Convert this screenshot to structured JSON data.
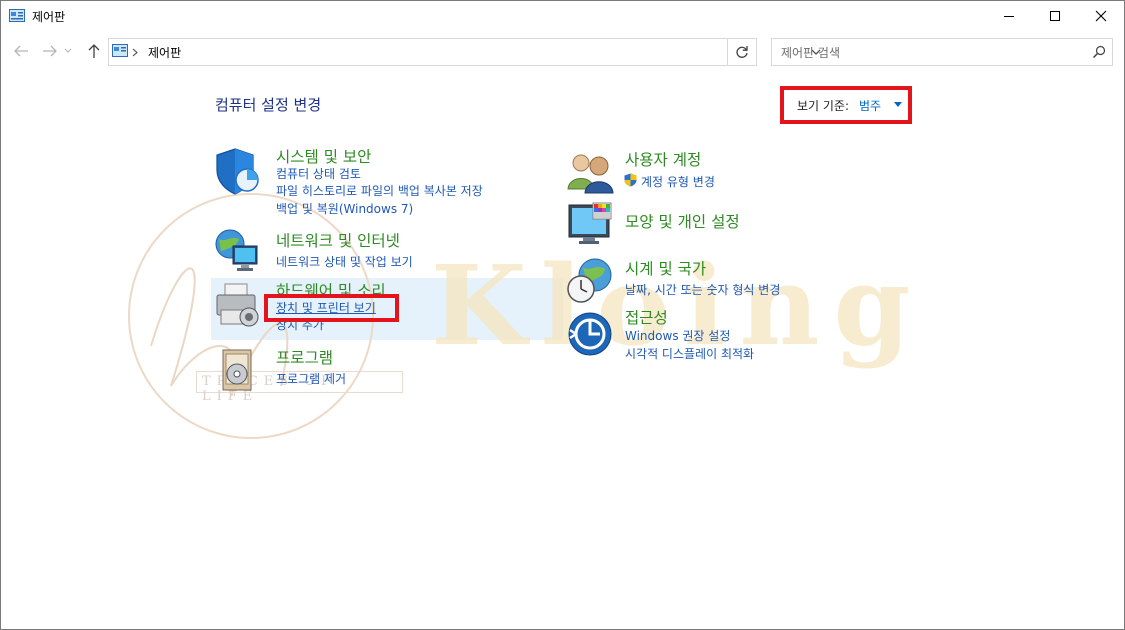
{
  "window": {
    "title": "제어판"
  },
  "address": {
    "path": "제어판"
  },
  "search": {
    "placeholder": "제어판 검색"
  },
  "main": {
    "heading": "컴퓨터 설정 변경",
    "view_by_label": "보기 기준:",
    "view_by_value": "범주"
  },
  "categories": {
    "system_security": {
      "title": "시스템 및 보안",
      "links": [
        "컴퓨터 상태 검토",
        "파일 히스토리로 파일의 백업 복사본 저장",
        "백업 및 복원(Windows 7)"
      ]
    },
    "network": {
      "title": "네트워크 및 인터넷",
      "links": [
        "네트워크 상태 및 작업 보기"
      ]
    },
    "hardware": {
      "title": "하드웨어 및 소리",
      "links": [
        "장치 및 프린터 보기",
        "장치 추가"
      ]
    },
    "programs": {
      "title": "프로그램",
      "links": [
        "프로그램 제거"
      ]
    },
    "user_accounts": {
      "title": "사용자 계정",
      "links": [
        "계정 유형 변경"
      ]
    },
    "appearance": {
      "title": "모양 및 개인 설정"
    },
    "clock_region": {
      "title": "시계 및 국가",
      "links": [
        "날짜, 시간 또는 숫자 형식 변경"
      ]
    },
    "ease_of_access": {
      "title": "접근성",
      "links": [
        "Windows 권장 설정",
        "시각적 디스플레이 최적화"
      ]
    }
  },
  "watermark": {
    "brand": "Kloing",
    "tagline": "TRACES OF LIFE"
  },
  "colors": {
    "category_title": "#2e8b23",
    "link": "#1f59b4",
    "highlight": "#e3141c",
    "hover": "#e5f1fb"
  }
}
